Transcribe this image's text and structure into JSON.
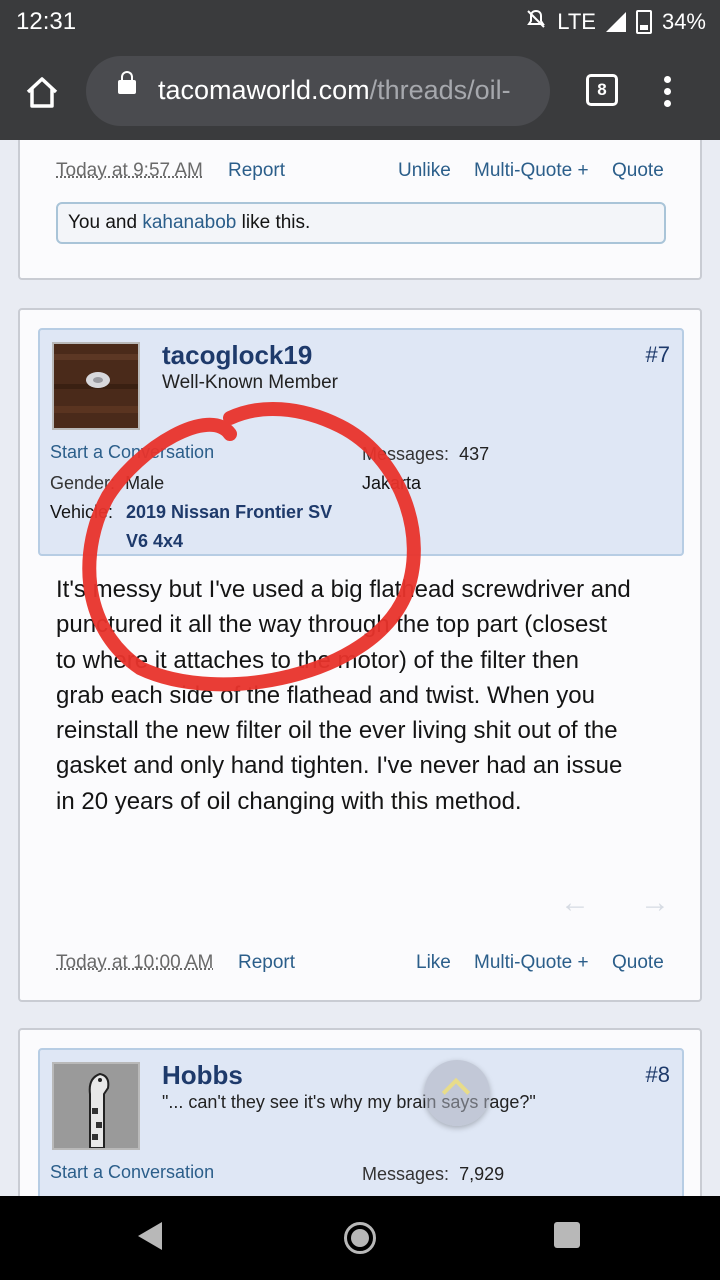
{
  "status_bar": {
    "time": "12:31",
    "network": "LTE",
    "battery": "34%"
  },
  "browser": {
    "url_domain": "tacomaworld.com",
    "url_path": "/threads/oil-",
    "tab_count": "8"
  },
  "prev_post": {
    "date": "Today at 9:57 AM",
    "report": "Report",
    "unlike": "Unlike",
    "multiquote": "Multi-Quote +",
    "quote": "Quote",
    "likes_prefix": "You and ",
    "likes_user": "kahanabob",
    "likes_suffix": " like this."
  },
  "post7": {
    "username": "tacoglock19",
    "user_title": "Well-Known Member",
    "post_number": "#7",
    "start_conversation": "Start a Conversation",
    "gender_label": "Gender:",
    "gender_value": "Male",
    "vehicle_label": "Vehicle:",
    "vehicle_value_1": "2019 Nissan Frontier SV",
    "vehicle_value_2": "V6 4x4",
    "messages_label": "Messages:",
    "messages_value": "437",
    "location_value": "Jakarta",
    "body_lines": [
      "It's messy but I've used a big flathead screwdriver and",
      "punctured it all the way through the top part (closest",
      "to where it attaches to the motor) of the filter then",
      "grab each side of the flathead and twist. When you",
      "reinstall the new filter oil the ever living shit out of the",
      "gasket and only hand tighten. I've never had an issue",
      "in 20 years of oil changing with this method."
    ],
    "date": "Today at 10:00 AM",
    "report": "Report",
    "like": "Like",
    "multiquote": "Multi-Quote +",
    "quote": "Quote"
  },
  "post8": {
    "username": "Hobbs",
    "user_title": "\"... can't they see it's why my brain says rage?\"",
    "post_number": "#8",
    "start_conversation": "Start a Conversation",
    "messages_label": "Messages:",
    "messages_value": "7,929"
  },
  "icons": {
    "home": "home-icon",
    "lock": "lock-icon",
    "menu": "overflow-menu-icon",
    "back": "back-icon",
    "home_nav": "home-nav-icon",
    "recents": "recents-icon"
  },
  "colors": {
    "username": "#1e3a6b",
    "link": "#2b5e8a",
    "annotation": "#e8332b"
  }
}
